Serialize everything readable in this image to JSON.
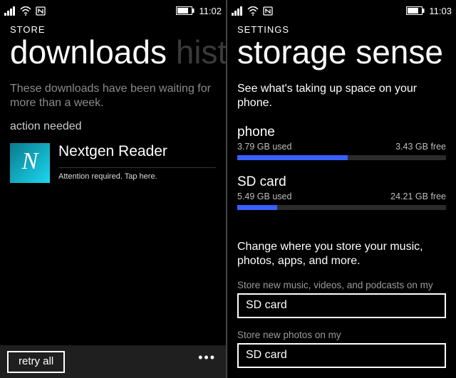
{
  "left": {
    "status": {
      "time": "11:02"
    },
    "header_small": "STORE",
    "tab_active": "downloads",
    "tab_inactive": "history",
    "message": "These downloads have been waiting for more than a week.",
    "action_needed": "action needed",
    "app": {
      "name": "Nextgen Reader",
      "status": "Attention required. Tap here.",
      "icon_letter": "N"
    },
    "retry_label": "retry all",
    "more_glyph": "•••"
  },
  "right": {
    "status": {
      "time": "11:03"
    },
    "header_small": "SETTINGS",
    "header_large": "storage sense",
    "desc": "See what's taking up space on your phone.",
    "storages": [
      {
        "title": "phone",
        "used": "3.79 GB used",
        "free": "3.43 GB free",
        "fill_pct": 53
      },
      {
        "title": "SD card",
        "used": "5.49 GB used",
        "free": "24.21 GB free",
        "fill_pct": 19
      }
    ],
    "change_desc": "Change where you store your music, photos, apps, and more.",
    "fields": [
      {
        "label": "Store new music, videos, and podcasts on my",
        "value": "SD card"
      },
      {
        "label": "Store new photos on my",
        "value": "SD card"
      }
    ]
  }
}
